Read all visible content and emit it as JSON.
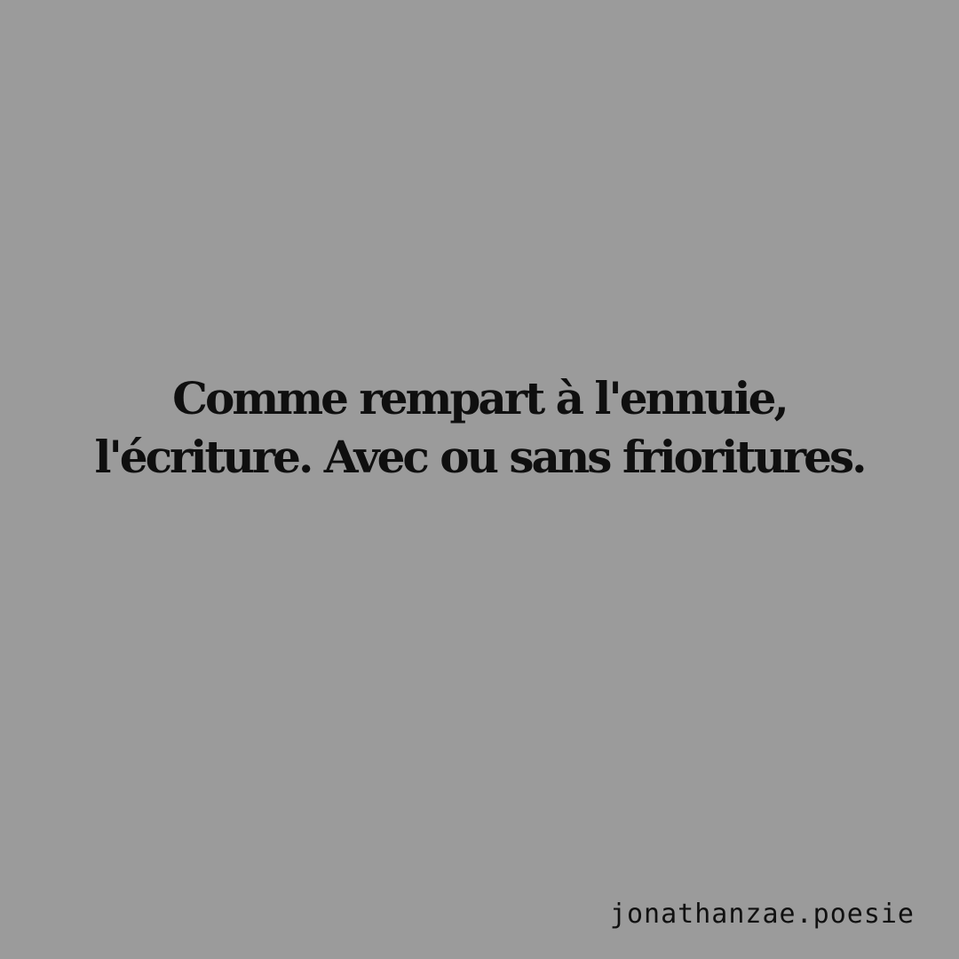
{
  "quote": {
    "lines": [
      "Comme rempart à l'ennuie,",
      "l'écriture. Avec ou sans frioritures."
    ]
  },
  "signature": "jonathanzae.poesie",
  "colors": {
    "background": "#9b9b9b",
    "text": "#0f0f0f"
  }
}
